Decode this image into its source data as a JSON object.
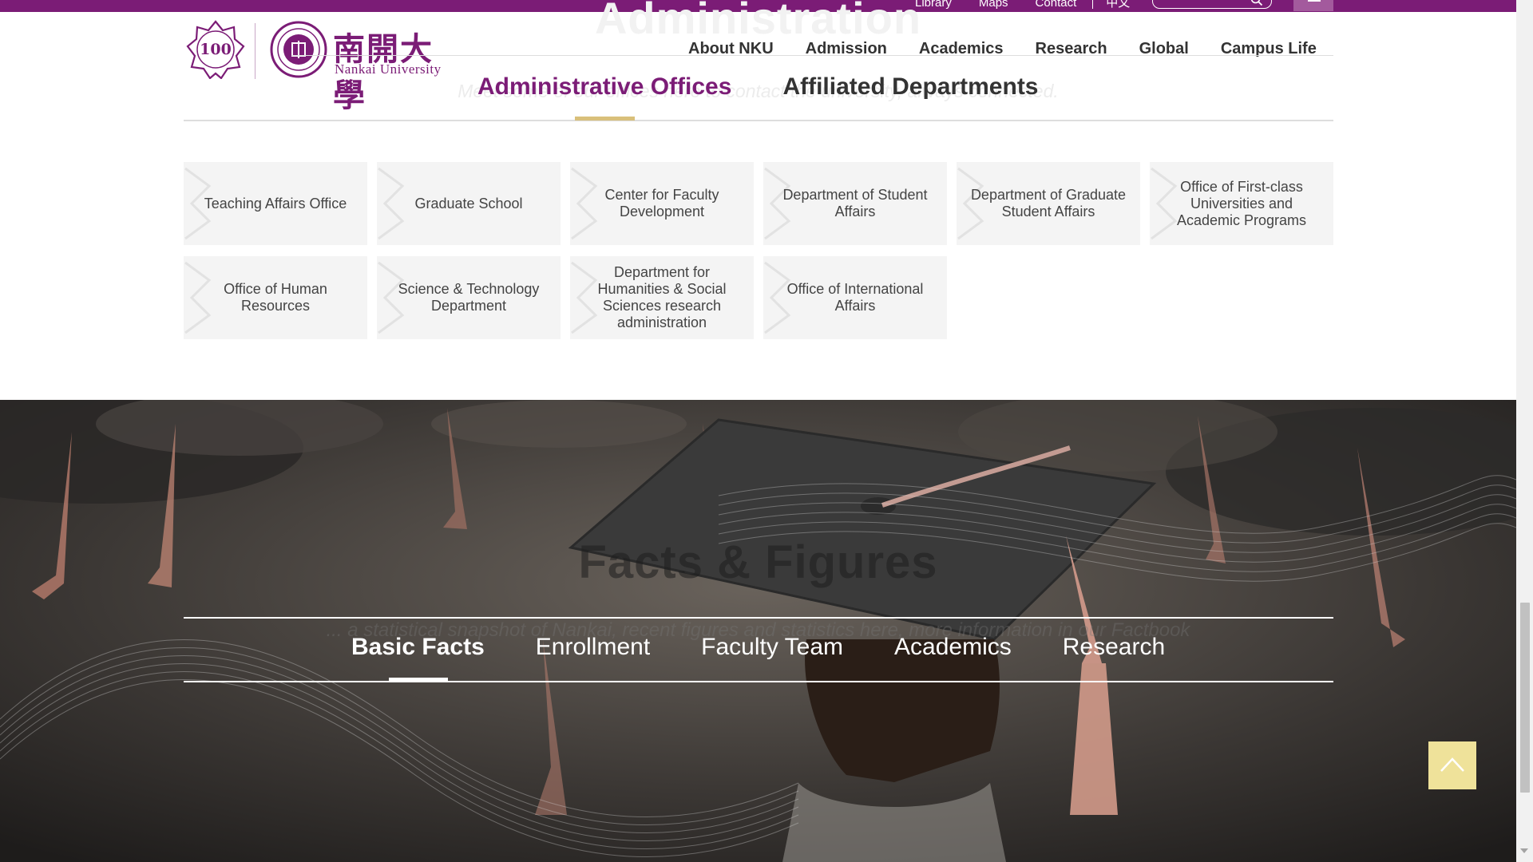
{
  "topbar": {
    "links": [
      "Library",
      "Maps",
      "Contact"
    ],
    "language": "中文",
    "search": {
      "placeholder": "",
      "icon": "search-icon"
    },
    "menu_icon": "hamburger-menu-icon"
  },
  "header": {
    "background_heading": "Administration",
    "logo": {
      "badge_text": "100",
      "name_cn": "南開大學",
      "name_en": "Nankai University"
    },
    "nav": [
      "About NKU",
      "Admission",
      "Academics",
      "Research",
      "Global",
      "Campus Life"
    ]
  },
  "offices": {
    "background_subtitle": "Meet some of our offices here to contact the university, always connected.",
    "tabs": [
      {
        "label": "Administrative Offices",
        "active": true
      },
      {
        "label": "Affiliated Departments",
        "active": false
      }
    ],
    "cards": [
      "Teaching Affairs Office",
      "Graduate School",
      "Center for Faculty Development",
      "Department of Student Affairs",
      "Department of Graduate Student Affairs",
      "Office of First-class Universities and Academic Programs",
      "Office of Human Resources",
      "Science & Technology Department",
      "Department for Humanities & Social Sciences research administration",
      "Office of International Affairs"
    ]
  },
  "facts": {
    "background_title": "Facts & Figures",
    "background_subtitle": "... a statistical snapshot of Nankai, recent figures and statistics here, more information in our Factbook",
    "tabs": [
      {
        "label": "Basic Facts",
        "active": true
      },
      {
        "label": "Enrollment",
        "active": false
      },
      {
        "label": "Faculty Team",
        "active": false
      },
      {
        "label": "Academics",
        "active": false
      },
      {
        "label": "Research",
        "active": false
      }
    ]
  },
  "back_to_top": {
    "icon": "chevron-up-icon"
  },
  "colors": {
    "brand_purple": "#7b1c76",
    "accent_gold": "#d9c07b",
    "back_to_top_bg": "#efe29a",
    "card_bg": "#f4f4f4"
  }
}
